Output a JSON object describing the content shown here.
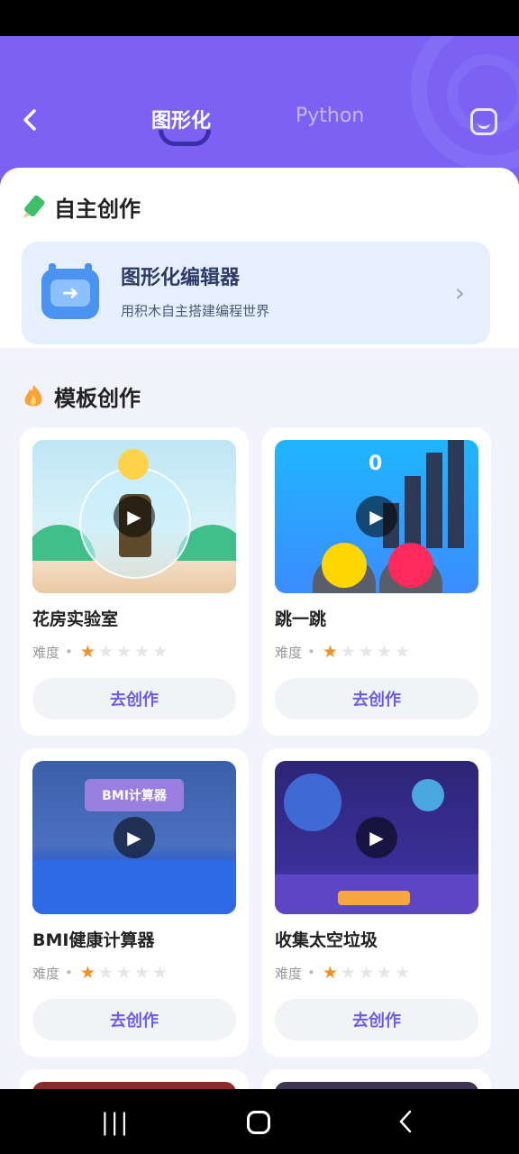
{
  "header": {
    "tab_graphical": "图形化",
    "tab_python": "Python",
    "back_icon": "chevron-left-icon",
    "right_icon": "share-icon"
  },
  "self_create": {
    "title": "自主创作",
    "editor": {
      "title": "图形化编辑器",
      "subtitle": "用积木自主搭建编程世界"
    }
  },
  "templates": {
    "title": "模板创作",
    "difficulty_label": "难度",
    "button_label": "去创作",
    "cards": [
      {
        "title": "花房实验室",
        "difficulty": 1,
        "max_difficulty": 5
      },
      {
        "title": "跳一跳",
        "difficulty": 1,
        "max_difficulty": 5,
        "thumb_text": "0"
      },
      {
        "title": "BMI健康计算器",
        "difficulty": 1,
        "max_difficulty": 5,
        "thumb_text": "BMI计算器"
      },
      {
        "title": "收集太空垃圾",
        "difficulty": 1,
        "max_difficulty": 5
      }
    ]
  },
  "colors": {
    "header_bg": "#7B62F5",
    "accent": "#6a5cf0",
    "star_on": "#f59020"
  }
}
